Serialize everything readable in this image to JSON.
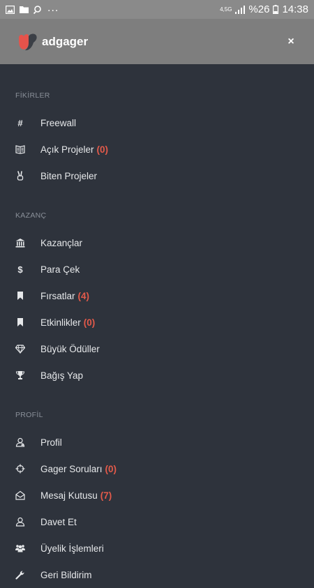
{
  "status_bar": {
    "network": "4,5G",
    "battery": "%26",
    "time": "14:38",
    "more": "..."
  },
  "header": {
    "title": "adgager",
    "close_label": "×"
  },
  "menu": {
    "sections": [
      {
        "label": "FİKİRLER",
        "items": [
          {
            "label": "Freewall",
            "icon": "hash-icon"
          },
          {
            "label": "Açık Projeler",
            "count": "(0)",
            "icon": "book-icon"
          },
          {
            "label": "Biten Projeler",
            "icon": "victory-hand-icon"
          }
        ]
      },
      {
        "label": "KAZANÇ",
        "items": [
          {
            "label": "Kazançlar",
            "icon": "bank-icon"
          },
          {
            "label": "Para Çek",
            "icon": "dollar-icon"
          },
          {
            "label": "Fırsatlar",
            "count": "(4)",
            "icon": "bookmark-icon"
          },
          {
            "label": "Etkinlikler",
            "count": "(0)",
            "icon": "bookmark-icon"
          },
          {
            "label": "Büyük Ödüller",
            "icon": "diamond-icon"
          },
          {
            "label": "Bağış Yap",
            "icon": "trophy-icon"
          }
        ]
      },
      {
        "label": "PROFİL",
        "items": [
          {
            "label": "Profil",
            "icon": "user-badge-icon"
          },
          {
            "label": "Gager Soruları",
            "count": "(0)",
            "icon": "crosshair-icon"
          },
          {
            "label": "Mesaj Kutusu",
            "count": "(7)",
            "icon": "envelope-open-icon"
          },
          {
            "label": "Davet Et",
            "icon": "user-icon"
          },
          {
            "label": "Üyelik İşlemleri",
            "icon": "users-icon"
          },
          {
            "label": "Geri Bildirim",
            "icon": "wrench-icon"
          }
        ]
      }
    ]
  },
  "colors": {
    "background": "#2e333c",
    "header": "#7e7e7e",
    "statusbar": "#8a8a8a",
    "count": "#e35a4a",
    "section_label": "#8a9099",
    "logo_red": "#e5534b",
    "logo_dark": "#3b3f46"
  }
}
